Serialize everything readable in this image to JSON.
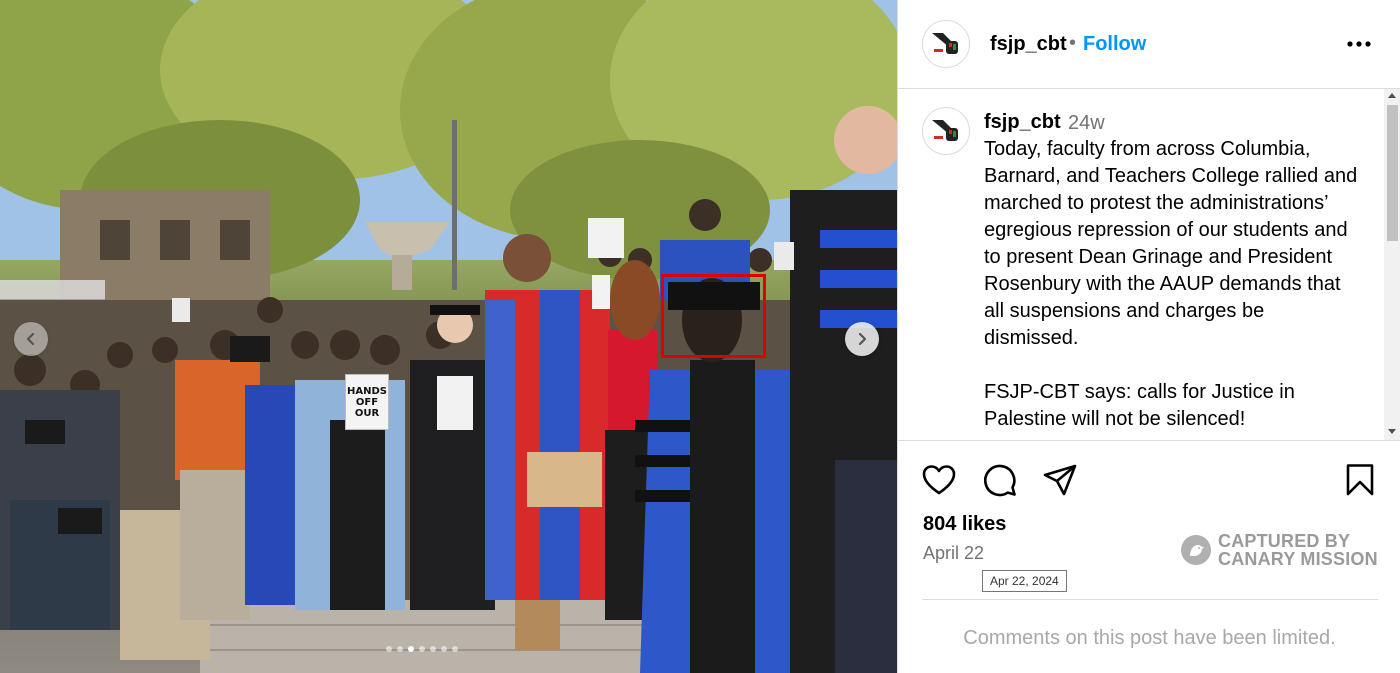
{
  "photo": {
    "sign_text": "HANDS OFF OUR",
    "carousel": {
      "slide_count": 7,
      "active_index": 2
    },
    "icons": {
      "prev": "chevron-left-icon",
      "next": "chevron-right-icon"
    },
    "highlight_color": "#e00000"
  },
  "header": {
    "username": "fsjp_cbt",
    "separator": "•",
    "follow_label": "Follow",
    "more_icon": "more-options-icon"
  },
  "caption": {
    "username": "fsjp_cbt",
    "time": "24w",
    "text": "Today, faculty from across Columbia, Barnard, and Teachers College rallied and marched to protest the administrations’ egregious repression of our students and to present Dean Grinage and President Rosenbury with the AAUP demands that all suspensions and charges be dismissed.\n\nFSJP-CBT says: calls for Justice in Palestine will not be silenced!"
  },
  "actions": {
    "like_icon": "heart-icon",
    "comment_icon": "comment-icon",
    "share_icon": "share-icon",
    "save_icon": "bookmark-icon"
  },
  "likes": "804 likes",
  "date": "April 22",
  "date_tooltip": "Apr 22, 2024",
  "watermark": {
    "line1": "CAPTURED BY",
    "line2": "CANARY MISSION"
  },
  "comments_limited": "Comments on this post have been limited.",
  "colors": {
    "follow": "#0095f6",
    "secondary_text": "#737373",
    "border": "#dbdbdb"
  }
}
